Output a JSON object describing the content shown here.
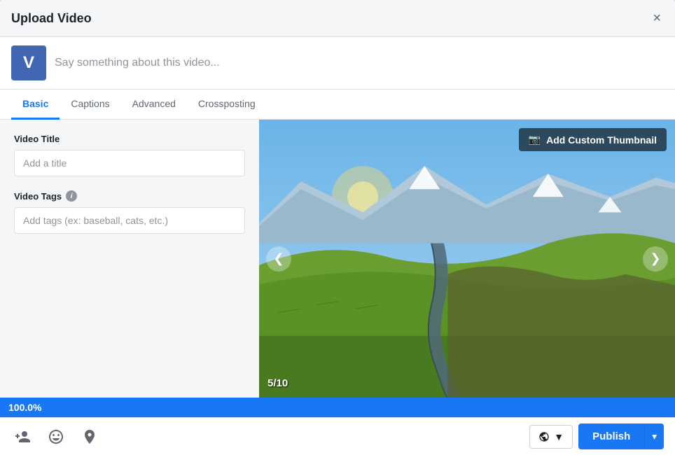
{
  "modal": {
    "title": "Upload Video",
    "close_label": "×"
  },
  "status": {
    "avatar_letter": "V",
    "placeholder": "Say something about this video..."
  },
  "tabs": [
    {
      "id": "basic",
      "label": "Basic",
      "active": true
    },
    {
      "id": "captions",
      "label": "Captions",
      "active": false
    },
    {
      "id": "advanced",
      "label": "Advanced",
      "active": false
    },
    {
      "id": "crossposting",
      "label": "Crossposting",
      "active": false
    }
  ],
  "basic_tab": {
    "video_title_label": "Video Title",
    "video_title_placeholder": "Add a title",
    "video_tags_label": "Video Tags",
    "video_tags_info": "i",
    "video_tags_placeholder": "Add tags (ex: baseball, cats, etc.)"
  },
  "thumbnail": {
    "add_custom_btn": "Add Custom Thumbnail",
    "counter": "5/10",
    "camera_icon": "📷",
    "left_arrow": "❮",
    "right_arrow": "❯"
  },
  "progress": {
    "value": "100.0%"
  },
  "footer": {
    "tag_friend_icon": "👤+",
    "emoji_icon": "😊",
    "location_icon": "📍",
    "privacy_label": "🌐",
    "privacy_arrow": "▼",
    "publish_label": "Publish",
    "dropdown_arrow": "▾"
  }
}
